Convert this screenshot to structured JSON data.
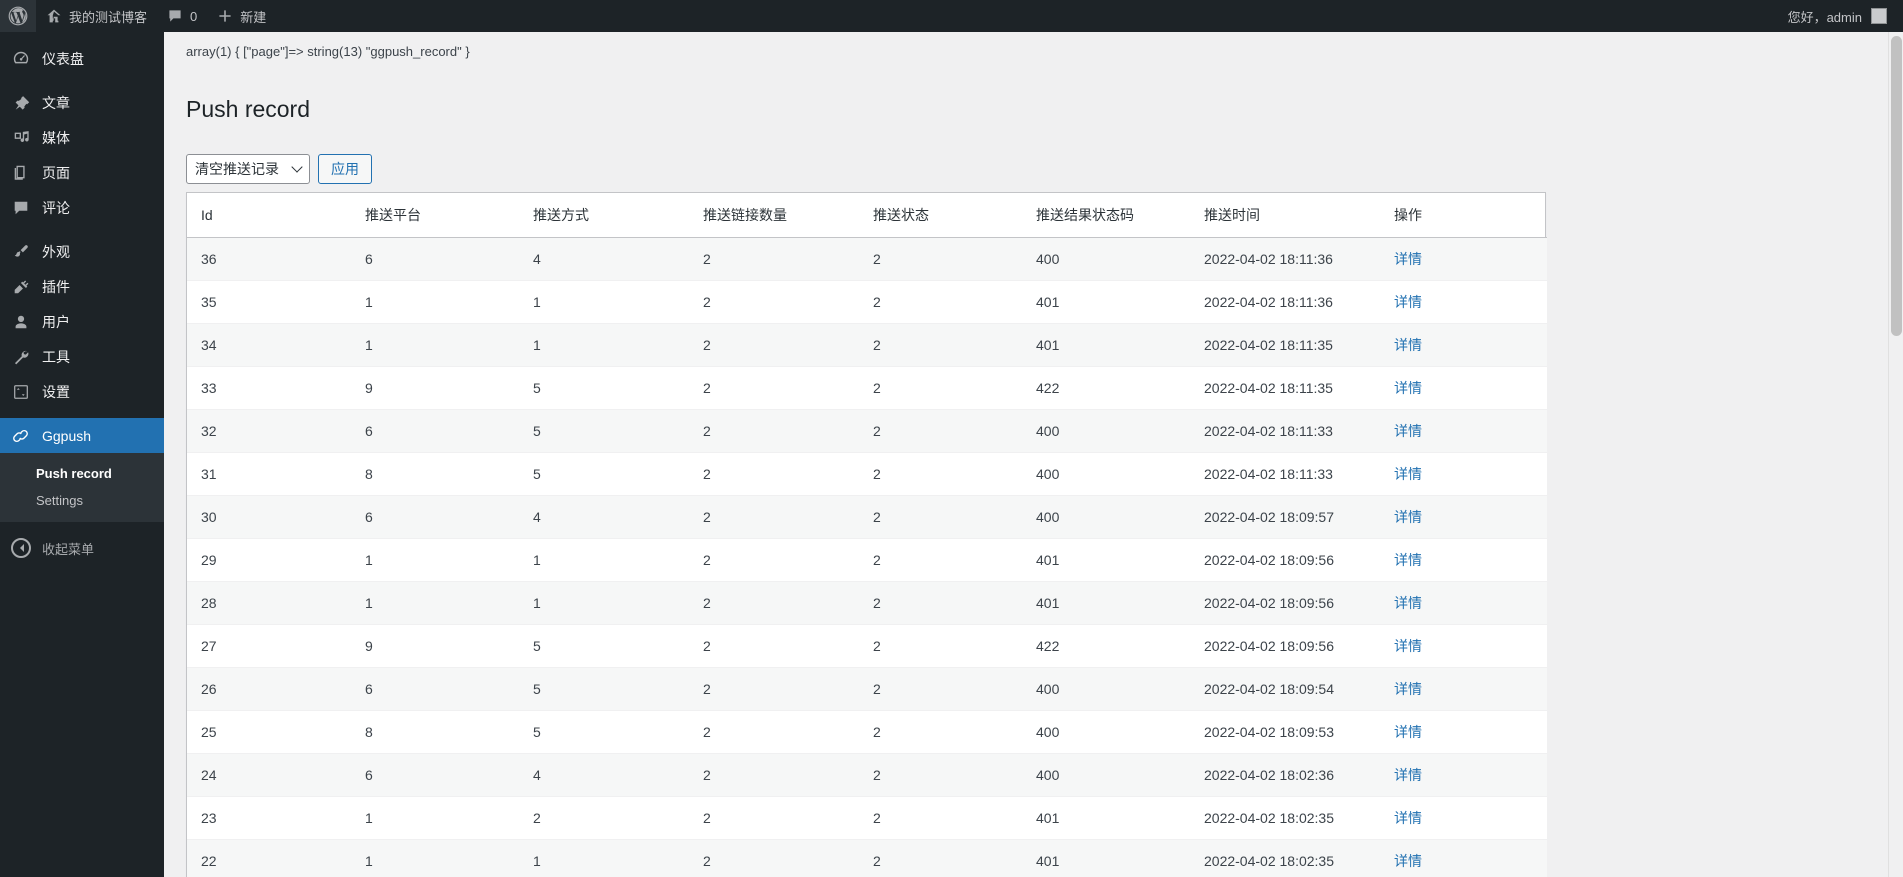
{
  "adminbar": {
    "logo_icon": "wordpress-logo-icon",
    "site_icon": "home-icon",
    "site_name": "我的测试博客",
    "comments_icon": "comment-bubble-icon",
    "comments_count": "0",
    "new_icon": "plus-icon",
    "new_label": "新建",
    "greeting": "您好，admin"
  },
  "sidebar": {
    "items": [
      {
        "label": "仪表盘",
        "icon": "dashboard-icon",
        "name": "dashboard"
      },
      {
        "label": "文章",
        "icon": "pin-icon",
        "name": "posts"
      },
      {
        "label": "媒体",
        "icon": "media-icon",
        "name": "media"
      },
      {
        "label": "页面",
        "icon": "pages-icon",
        "name": "pages"
      },
      {
        "label": "评论",
        "icon": "comment-bubble-icon",
        "name": "comments"
      },
      {
        "label": "外观",
        "icon": "paintbrush-icon",
        "name": "appearance"
      },
      {
        "label": "插件",
        "icon": "plug-icon",
        "name": "plugins"
      },
      {
        "label": "用户",
        "icon": "user-icon",
        "name": "users"
      },
      {
        "label": "工具",
        "icon": "wrench-icon",
        "name": "tools"
      },
      {
        "label": "设置",
        "icon": "sliders-icon",
        "name": "settings"
      },
      {
        "label": "Ggpush",
        "icon": "link-icon",
        "name": "ggpush"
      }
    ],
    "submenu": [
      {
        "label": "Push record",
        "name": "push-record"
      },
      {
        "label": "Settings",
        "name": "settings"
      }
    ],
    "collapse_label": "收起菜单",
    "collapse_icon": "collapse-arrow-icon",
    "active_color": "#2271b1"
  },
  "content": {
    "debug_output": "array(1) { [\"page\"]=> string(13) \"ggpush_record\" }",
    "page_title": "Push record",
    "bulk_action_value": "清空推送记录",
    "bulk_action_options": [
      "清空推送记录"
    ],
    "apply_label": "应用",
    "dropdown_icon": "chevron-down-icon"
  },
  "table": {
    "columns": [
      "Id",
      "推送平台",
      "推送方式",
      "推送链接数量",
      "推送状态",
      "推送结果状态码",
      "推送时间",
      "操作"
    ],
    "action_label": "详情",
    "rows": [
      {
        "id": "36",
        "platform": "6",
        "method": "4",
        "count": "2",
        "status": "2",
        "code": "400",
        "time": "2022-04-02 18:11:36",
        "action": "详情"
      },
      {
        "id": "35",
        "platform": "1",
        "method": "1",
        "count": "2",
        "status": "2",
        "code": "401",
        "time": "2022-04-02 18:11:36",
        "action": "详情"
      },
      {
        "id": "34",
        "platform": "1",
        "method": "1",
        "count": "2",
        "status": "2",
        "code": "401",
        "time": "2022-04-02 18:11:35",
        "action": "详情"
      },
      {
        "id": "33",
        "platform": "9",
        "method": "5",
        "count": "2",
        "status": "2",
        "code": "422",
        "time": "2022-04-02 18:11:35",
        "action": "详情"
      },
      {
        "id": "32",
        "platform": "6",
        "method": "5",
        "count": "2",
        "status": "2",
        "code": "400",
        "time": "2022-04-02 18:11:33",
        "action": "详情"
      },
      {
        "id": "31",
        "platform": "8",
        "method": "5",
        "count": "2",
        "status": "2",
        "code": "400",
        "time": "2022-04-02 18:11:33",
        "action": "详情"
      },
      {
        "id": "30",
        "platform": "6",
        "method": "4",
        "count": "2",
        "status": "2",
        "code": "400",
        "time": "2022-04-02 18:09:57",
        "action": "详情"
      },
      {
        "id": "29",
        "platform": "1",
        "method": "1",
        "count": "2",
        "status": "2",
        "code": "401",
        "time": "2022-04-02 18:09:56",
        "action": "详情"
      },
      {
        "id": "28",
        "platform": "1",
        "method": "1",
        "count": "2",
        "status": "2",
        "code": "401",
        "time": "2022-04-02 18:09:56",
        "action": "详情"
      },
      {
        "id": "27",
        "platform": "9",
        "method": "5",
        "count": "2",
        "status": "2",
        "code": "422",
        "time": "2022-04-02 18:09:56",
        "action": "详情"
      },
      {
        "id": "26",
        "platform": "6",
        "method": "5",
        "count": "2",
        "status": "2",
        "code": "400",
        "time": "2022-04-02 18:09:54",
        "action": "详情"
      },
      {
        "id": "25",
        "platform": "8",
        "method": "5",
        "count": "2",
        "status": "2",
        "code": "400",
        "time": "2022-04-02 18:09:53",
        "action": "详情"
      },
      {
        "id": "24",
        "platform": "6",
        "method": "4",
        "count": "2",
        "status": "2",
        "code": "400",
        "time": "2022-04-02 18:02:36",
        "action": "详情"
      },
      {
        "id": "23",
        "platform": "1",
        "method": "2",
        "count": "2",
        "status": "2",
        "code": "401",
        "time": "2022-04-02 18:02:35",
        "action": "详情"
      },
      {
        "id": "22",
        "platform": "1",
        "method": "1",
        "count": "2",
        "status": "2",
        "code": "401",
        "time": "2022-04-02 18:02:35",
        "action": "详情"
      }
    ]
  }
}
